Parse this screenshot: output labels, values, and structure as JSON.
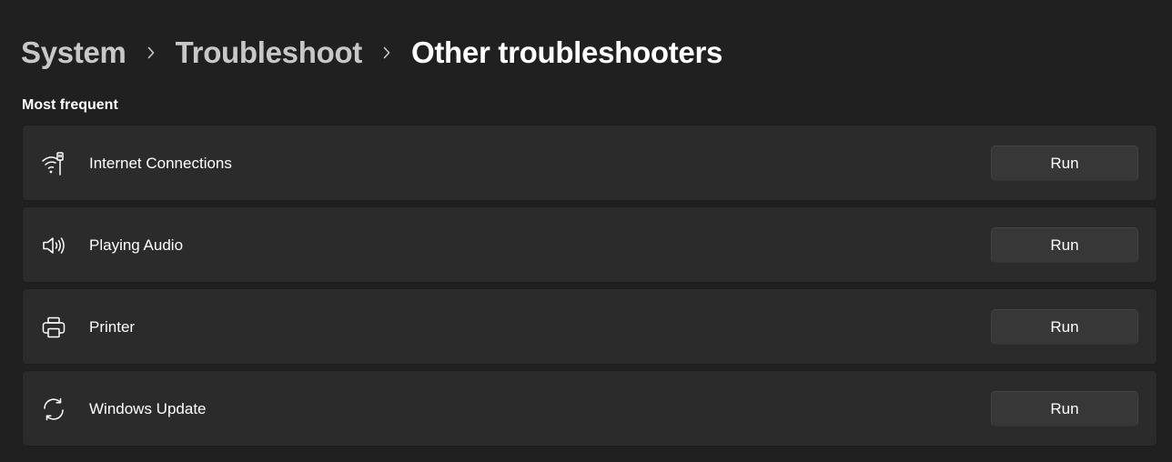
{
  "breadcrumb": {
    "items": [
      "System",
      "Troubleshoot",
      "Other troubleshooters"
    ]
  },
  "section": {
    "title": "Most frequent"
  },
  "troubleshooters": [
    {
      "label": "Internet Connections",
      "icon": "wifi-ethernet-icon",
      "button": "Run"
    },
    {
      "label": "Playing Audio",
      "icon": "speaker-icon",
      "button": "Run"
    },
    {
      "label": "Printer",
      "icon": "printer-icon",
      "button": "Run"
    },
    {
      "label": "Windows Update",
      "icon": "sync-icon",
      "button": "Run"
    }
  ],
  "colors": {
    "background": "#202020",
    "card": "#2b2b2b",
    "button": "#373737",
    "breadcrumb_past": "#c8c8c8",
    "text": "#ffffff"
  }
}
